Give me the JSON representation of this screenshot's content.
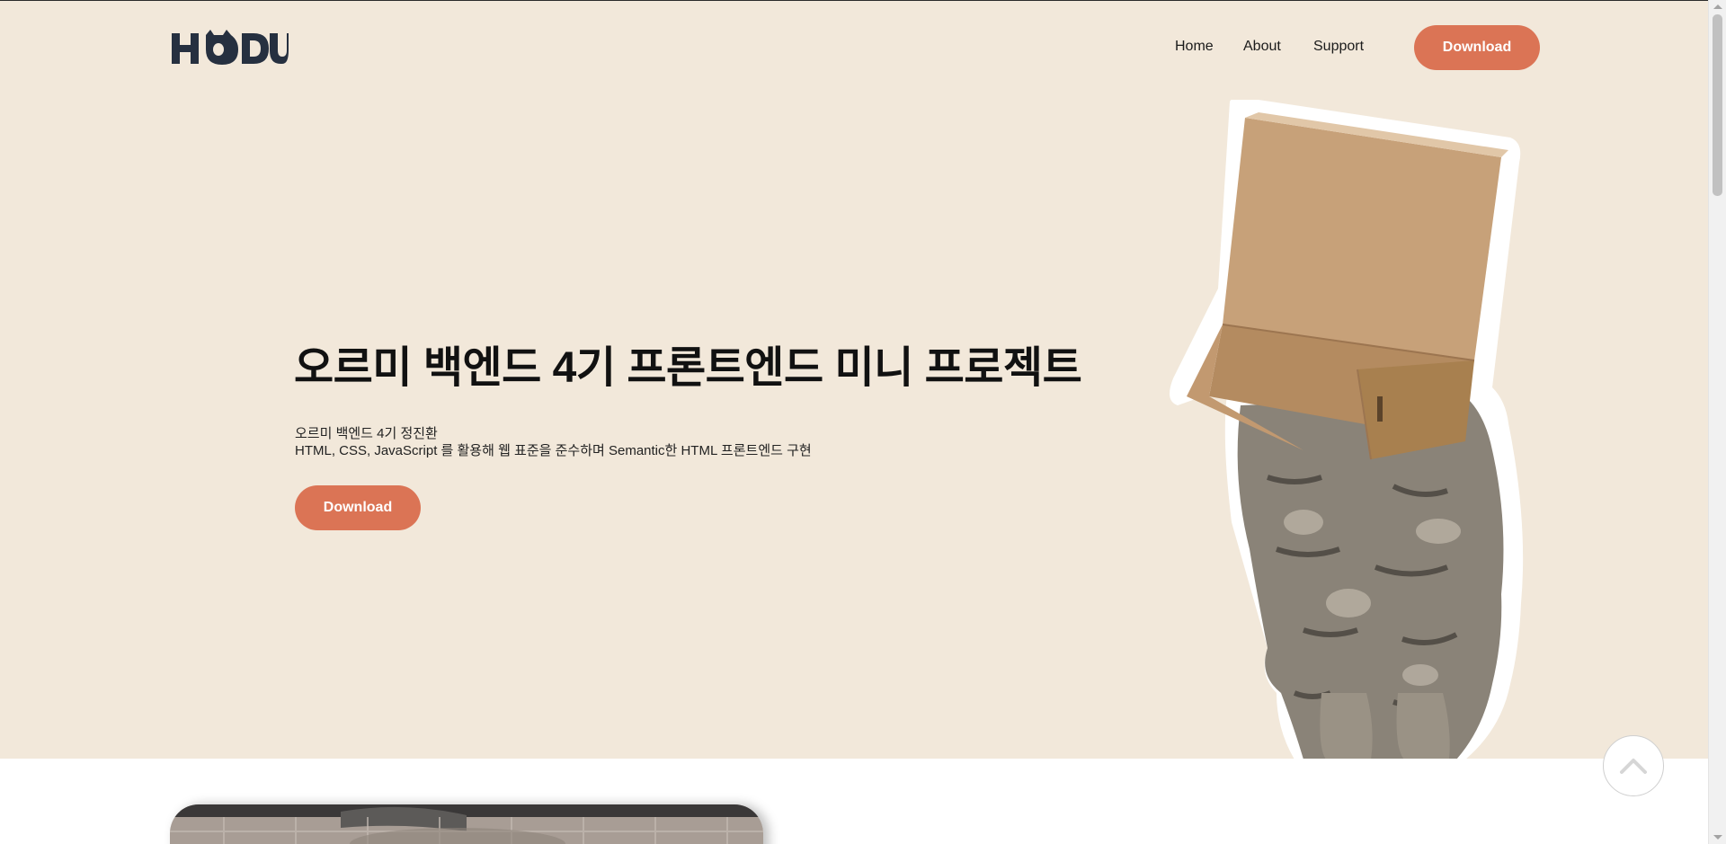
{
  "header": {
    "logo_text": "HODU",
    "nav": {
      "home": "Home",
      "about": "About",
      "support": "Support"
    },
    "download_label": "Download"
  },
  "hero": {
    "title": "오르미 백엔드 4기 프론트엔드 미니 프로젝트",
    "subtitle_line1": "오르미 백엔드 4기 정진환",
    "subtitle_line2": "HTML, CSS, JavaScript 를 활용해 웹 표준을 준수하며 Semantic한 HTML 프론트엔드 구현",
    "download_label": "Download",
    "image_icon": "cat-in-box-icon"
  },
  "scroll_top_icon": "chevron-up-icon",
  "colors": {
    "hero_background": "#f2e8da",
    "accent": "#db7455",
    "logo": "#263040",
    "page_background": "#ffffff"
  }
}
